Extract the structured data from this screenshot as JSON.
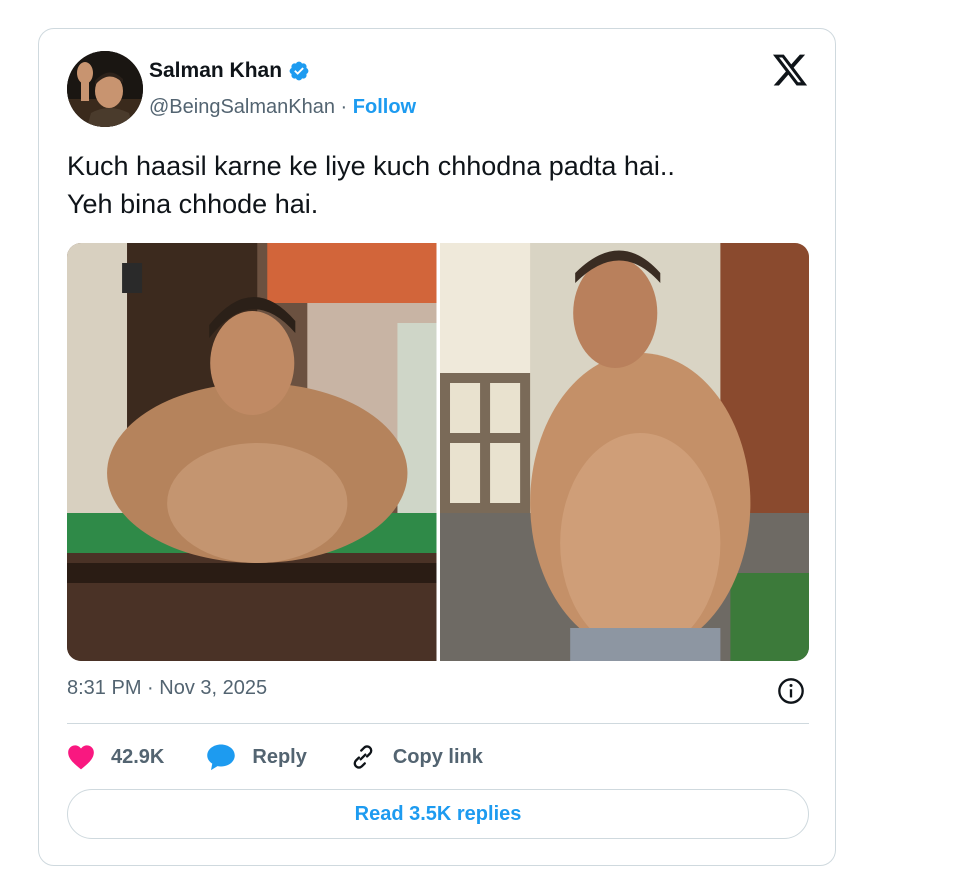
{
  "author": {
    "name": "Salman Khan",
    "handle": "@BeingSalmanKhan",
    "separator": " · ",
    "follow_label": "Follow"
  },
  "tweet": {
    "lines": [
      "Kuch haasil karne ke liye kuch chhodna padta hai..",
      "Yeh bina chhode hai."
    ],
    "time": "8:31 PM",
    "date_separator": " · ",
    "date": "Nov 3, 2025"
  },
  "actions": {
    "like_count": "42.9K",
    "reply_label": "Reply",
    "copy_label": "Copy link"
  },
  "read_replies_label": "Read 3.5K replies",
  "icons": {
    "verified": "verified-badge-icon",
    "platform": "x-logo-icon",
    "info": "info-icon",
    "like": "heart-icon",
    "reply": "speech-bubble-icon",
    "copy": "link-icon"
  },
  "colors": {
    "accent": "#1d9bf0",
    "like": "#f91880",
    "muted": "#536471",
    "border": "#cfd9de"
  }
}
